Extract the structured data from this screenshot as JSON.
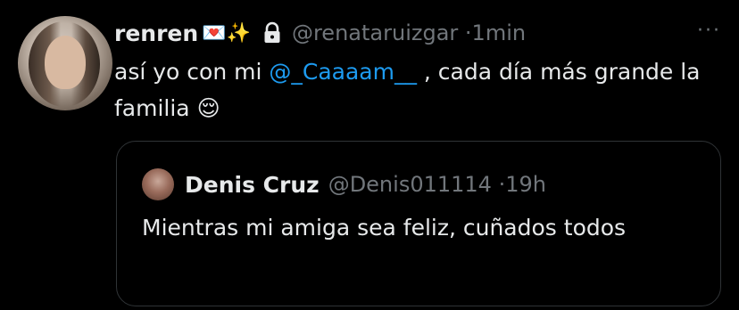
{
  "tweet": {
    "author_name": "renren",
    "author_emojis": "💌✨",
    "handle": "@renataruizgar",
    "separator": "·",
    "time": "1min",
    "more": "···",
    "text_before": "así yo con mi ",
    "mention": "@_Caaaam__",
    "text_after": " , cada día más grande la familia ",
    "text_emoji": "😌"
  },
  "quote": {
    "author_name": "Denis Cruz",
    "handle": "@Denis011114",
    "separator": "·",
    "time": "19h",
    "text": "Mientras mi amiga sea feliz, cuñados todos"
  },
  "icons": {
    "lock": "lock-icon",
    "more": "more-dots-icon"
  },
  "colors": {
    "background": "#000000",
    "text": "#e7e9ea",
    "secondary": "#71767b",
    "mention": "#1d9bf0",
    "border": "#2f3336"
  }
}
